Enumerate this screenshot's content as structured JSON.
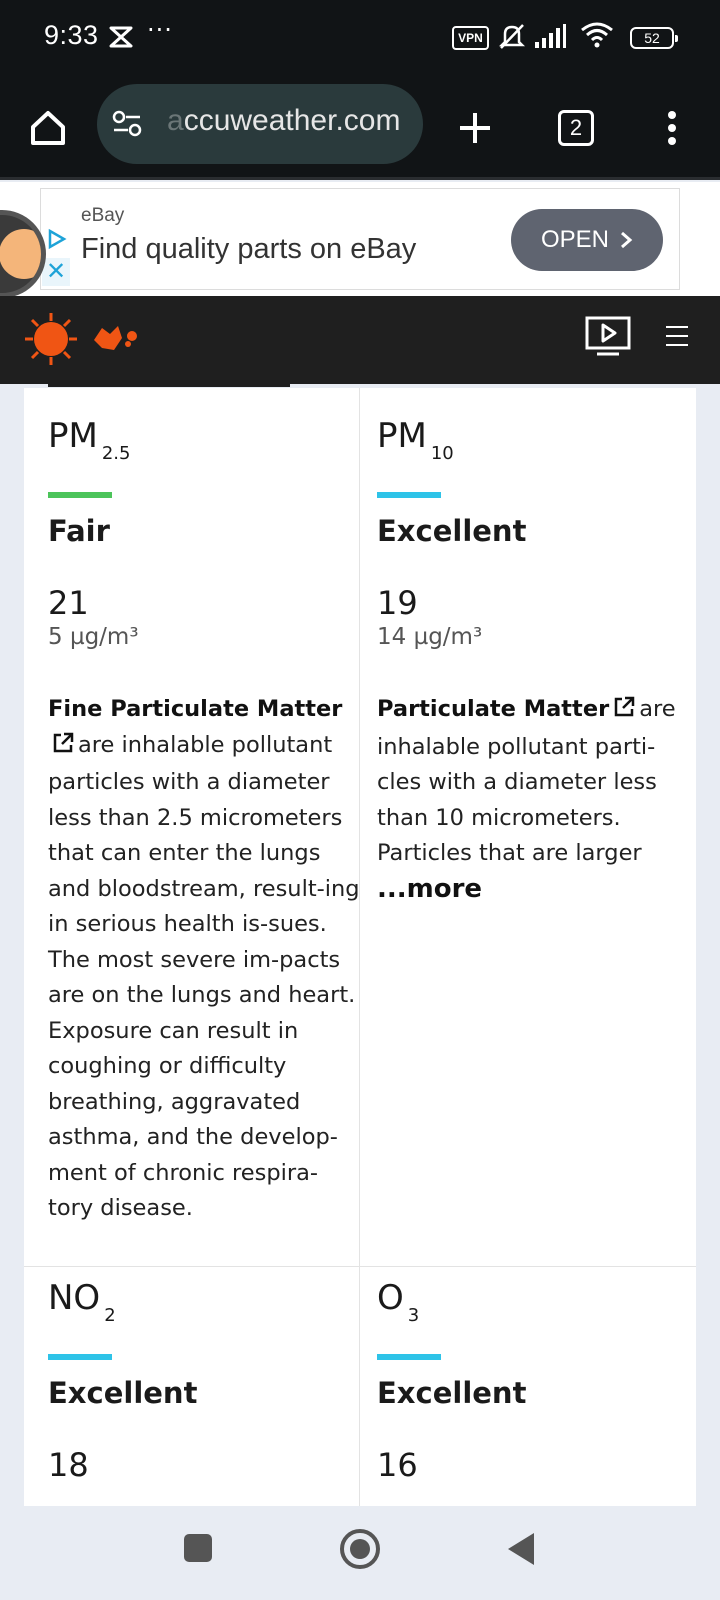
{
  "status_bar": {
    "time": "9:33",
    "more": "···",
    "vpn": "VPN",
    "battery": "52"
  },
  "browser": {
    "url_visible": "ccuweather.com",
    "url_faded": "a",
    "tab_count": "2"
  },
  "ad": {
    "brand": "eBay",
    "headline": "Find quality parts on eBay",
    "cta": "OPEN",
    "close": "✕"
  },
  "pollutants": [
    {
      "name": "PM",
      "sub": "2.5",
      "bar_color": "#4cc45a",
      "rating": "Fair",
      "index": "21",
      "concentration": "5 µg/m³",
      "desc_link": "Fine Particulate Matter",
      "desc_text": "are inhalable pollutant particles with a diameter less than 2.5 micrometers that can enter the lungs and bloodstream, result-ing in serious health is-sues. The most severe im-pacts are on the lungs and heart. Exposure can result in coughing or difficulty breathing, aggravated asthma, and the develop-ment of chronic respira-tory disease.",
      "more": ""
    },
    {
      "name": "PM",
      "sub": "10",
      "bar_color": "#2ec3e8",
      "rating": "Excellent",
      "index": "19",
      "concentration": "14 µg/m³",
      "desc_link": "Particulate Matter",
      "desc_text": "are inhalable pollutant parti-cles with a diameter less than 10 micrometers. Particles that are larger",
      "more": "...more"
    },
    {
      "name": "NO",
      "sub": "2",
      "bar_color": "#2ec3e8",
      "rating": "Excellent",
      "index": "18"
    },
    {
      "name": "O",
      "sub": "3",
      "bar_color": "#2ec3e8",
      "rating": "Excellent",
      "index": "16"
    }
  ],
  "colors": {
    "fair": "#4cc45a",
    "excellent": "#2ec3e8",
    "brand_orange": "#f05514"
  }
}
